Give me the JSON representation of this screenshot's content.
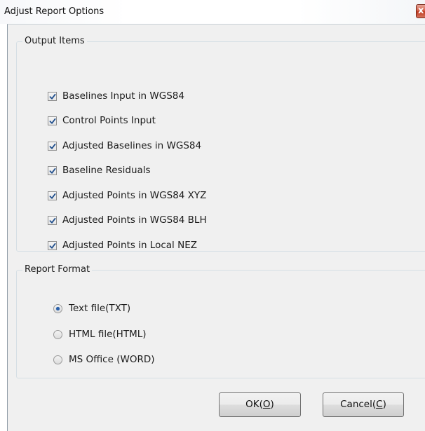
{
  "window": {
    "title": "Adjust Report Options",
    "close_glyph": "x"
  },
  "output_items": {
    "legend": "Output Items",
    "items": [
      {
        "label": "Baselines Input in WGS84",
        "checked": true
      },
      {
        "label": "Control Points Input",
        "checked": true
      },
      {
        "label": "Adjusted Baselines in WGS84",
        "checked": true
      },
      {
        "label": "Baseline Residuals",
        "checked": true
      },
      {
        "label": "Adjusted Points in WGS84 XYZ",
        "checked": true
      },
      {
        "label": "Adjusted Points in WGS84 BLH",
        "checked": true
      },
      {
        "label": "Adjusted Points in Local NEZ",
        "checked": true
      }
    ]
  },
  "report_format": {
    "legend": "Report Format",
    "options": [
      {
        "label": "Text file(TXT)",
        "selected": true
      },
      {
        "label": "HTML file(HTML)",
        "selected": false
      },
      {
        "label": "MS Office (WORD)",
        "selected": false
      }
    ]
  },
  "buttons": {
    "ok": {
      "text": "OK(",
      "mnemonic": "O",
      "close": ")"
    },
    "cancel": {
      "text": "Cancel(",
      "mnemonic": "C",
      "close": ")"
    }
  },
  "colors": {
    "dialog_background": "#f0f0f0",
    "check_mark": "#1e4d8c",
    "radio_dot": "#2a5fa8",
    "close_button": "#c0391f"
  },
  "icons": {
    "close": "close-icon",
    "check": "check-icon",
    "radio": "radio-dot-icon"
  }
}
